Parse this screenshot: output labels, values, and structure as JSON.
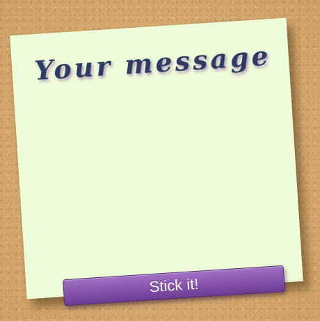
{
  "note": {
    "message": "Your message"
  },
  "actions": {
    "stick_label": "Stick it!"
  },
  "colors": {
    "corkboard": "#d8ad72",
    "note": "#eefdd9",
    "handwriting": "#2e3c63",
    "button": "#8b57b1"
  }
}
